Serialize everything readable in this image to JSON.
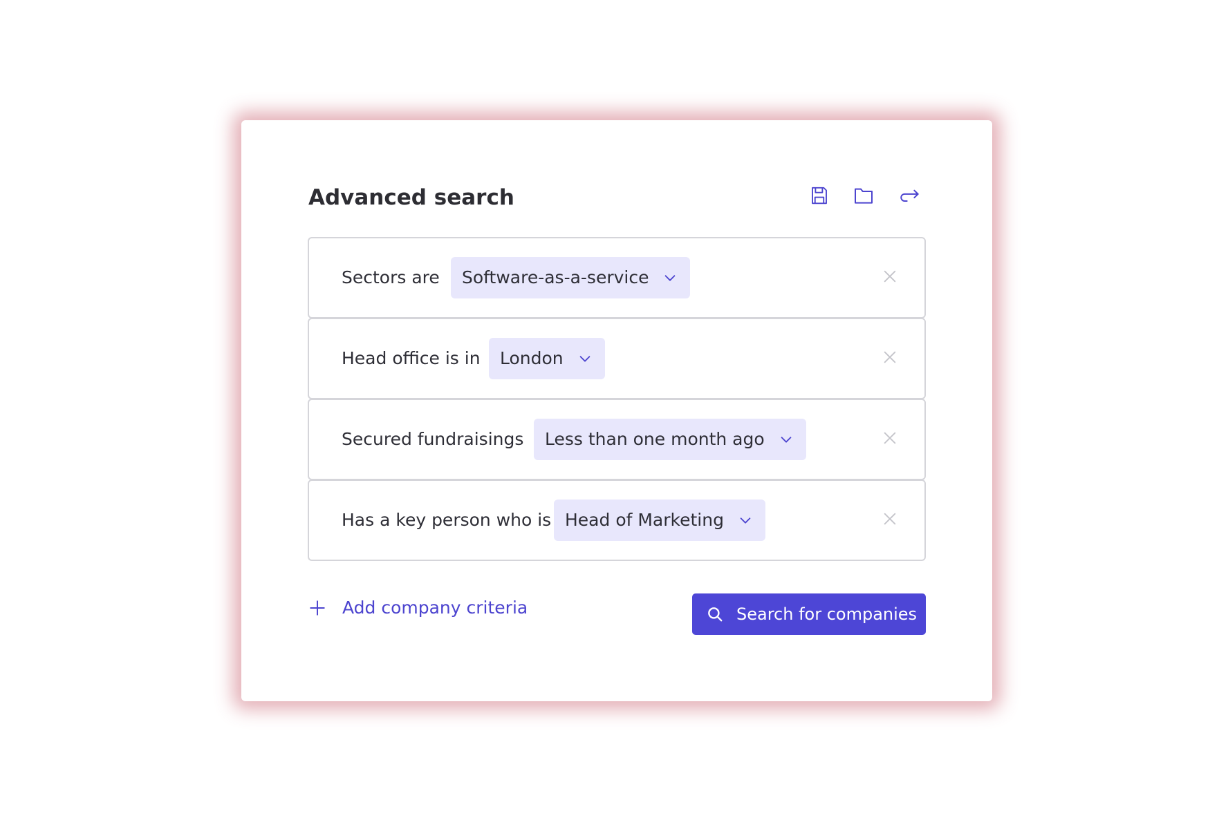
{
  "panel": {
    "title": "Advanced search",
    "toolbar": {
      "icons": [
        "save-icon",
        "folder-icon",
        "undo-icon"
      ]
    },
    "criteria": [
      {
        "label": "Sectors are",
        "value": "Software-as-a-service"
      },
      {
        "label": "Head office is in",
        "value": "London"
      },
      {
        "label": "Secured fundraisings",
        "value": "Less than one month ago"
      },
      {
        "label": "Has a key person who is",
        "value": "Head of Marketing"
      }
    ],
    "add_criteria_label": "Add company criteria",
    "search_button_label": "Search for companies"
  },
  "colors": {
    "accent": "#4d46d6",
    "dropdown_bg": "#e8e7fc",
    "border": "#d5d5da",
    "text": "#2e2e36",
    "muted_icon": "#c4c4ca",
    "shadow": "#c45060"
  }
}
